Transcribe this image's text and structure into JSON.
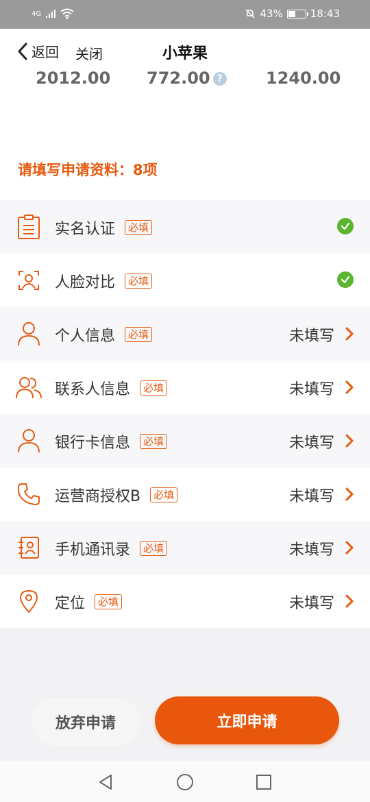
{
  "status_bar": {
    "network": "4G",
    "battery_percent": "43%",
    "battery_level": 0.43,
    "time": "18:43"
  },
  "nav": {
    "back_label": "返回",
    "close_label": "关闭",
    "title": "小苹果"
  },
  "amounts": {
    "a1": "2012.00",
    "a2": "772.00",
    "a3": "1240.00",
    "help_glyph": "?"
  },
  "prompt": "请填写申请资料：8项",
  "items": [
    {
      "label": "实名认证",
      "tag": "必填",
      "status": "",
      "done": true,
      "icon": "clipboard-icon"
    },
    {
      "label": "人脸对比",
      "tag": "必填",
      "status": "",
      "done": true,
      "icon": "face-scan-icon"
    },
    {
      "label": "个人信息",
      "tag": "必填",
      "status": "未填写",
      "done": false,
      "icon": "person-icon"
    },
    {
      "label": "联系人信息",
      "tag": "必填",
      "status": "未填写",
      "done": false,
      "icon": "contacts-icon"
    },
    {
      "label": "银行卡信息",
      "tag": "必填",
      "status": "未填写",
      "done": false,
      "icon": "person-icon"
    },
    {
      "label": "运营商授权B",
      "tag": "必填",
      "status": "未填写",
      "done": false,
      "icon": "phone-icon"
    },
    {
      "label": "手机通讯录",
      "tag": "必填",
      "status": "未填写",
      "done": false,
      "icon": "address-book-icon"
    },
    {
      "label": "定位",
      "tag": "必填",
      "status": "未填写",
      "done": false,
      "icon": "location-pin-icon"
    }
  ],
  "buttons": {
    "abandon": "放弃申请",
    "apply": "立即申请"
  },
  "colors": {
    "accent": "#e8570b",
    "success": "#5cb531"
  }
}
